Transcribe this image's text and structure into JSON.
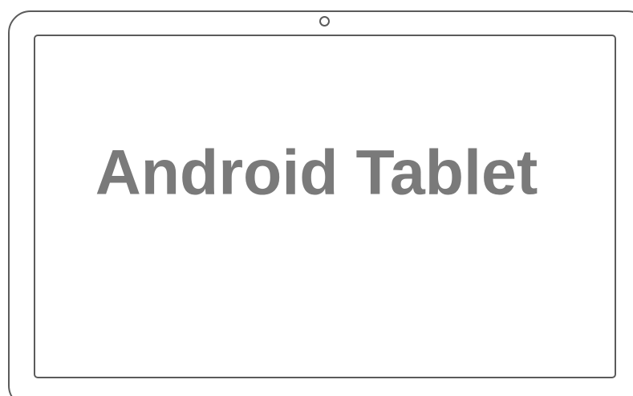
{
  "device": {
    "screen_text": "Android Tablet"
  },
  "colors": {
    "outline": "#5b5b5b",
    "text": "#7a7a7a",
    "background": "#ffffff"
  }
}
